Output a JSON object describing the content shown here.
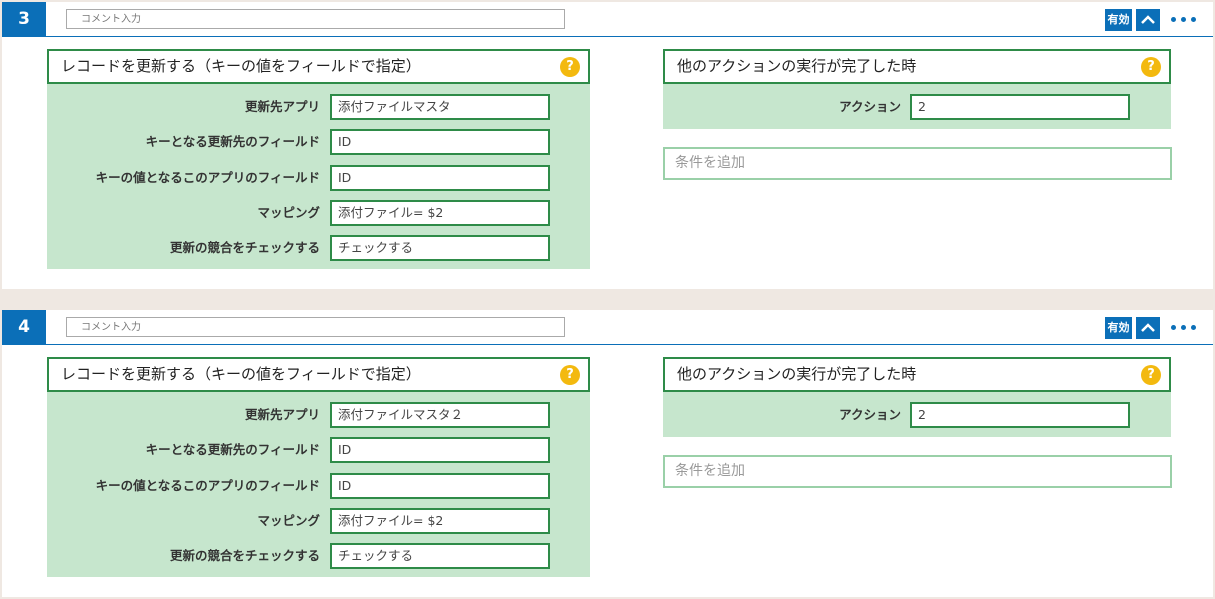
{
  "cards": [
    {
      "number": "3",
      "comment_placeholder": "コメント入力",
      "enabled_label": "有効",
      "action": {
        "title": "レコードを更新する（キーの値をフィールドで指定）",
        "help": "?",
        "fields": [
          {
            "label": "更新先アプリ",
            "value": "添付ファイルマスタ"
          },
          {
            "label": "キーとなる更新先のフィールド",
            "value": "ID"
          },
          {
            "label": "キーの値となるこのアプリのフィールド",
            "value": "ID"
          },
          {
            "label": "マッピング",
            "value": "添付ファイル= $2"
          },
          {
            "label": "更新の競合をチェックする",
            "value": "チェックする"
          }
        ]
      },
      "condition": {
        "title": "他のアクションの実行が完了した時",
        "help": "?",
        "field_label": "アクション",
        "field_value": "2",
        "add_label": "条件を追加"
      }
    },
    {
      "number": "4",
      "comment_placeholder": "コメント入力",
      "enabled_label": "有効",
      "action": {
        "title": "レコードを更新する（キーの値をフィールドで指定）",
        "help": "?",
        "fields": [
          {
            "label": "更新先アプリ",
            "value": "添付ファイルマスタ２"
          },
          {
            "label": "キーとなる更新先のフィールド",
            "value": "ID"
          },
          {
            "label": "キーの値となるこのアプリのフィールド",
            "value": "ID"
          },
          {
            "label": "マッピング",
            "value": "添付ファイル= $2"
          },
          {
            "label": "更新の競合をチェックする",
            "value": "チェックする"
          }
        ]
      },
      "condition": {
        "title": "他のアクションの実行が完了した時",
        "help": "?",
        "field_label": "アクション",
        "field_value": "2",
        "add_label": "条件を追加"
      }
    }
  ],
  "icons": {
    "collapse": "chevron-up-icon",
    "more": "more-dots-icon",
    "help": "help-icon"
  },
  "colors": {
    "accent_blue": "#0b6fb8",
    "panel_green": "#c6e6cd",
    "border_green": "#2e8b48",
    "help_yellow": "#f3b90f",
    "page_bg": "#efe8e2"
  }
}
